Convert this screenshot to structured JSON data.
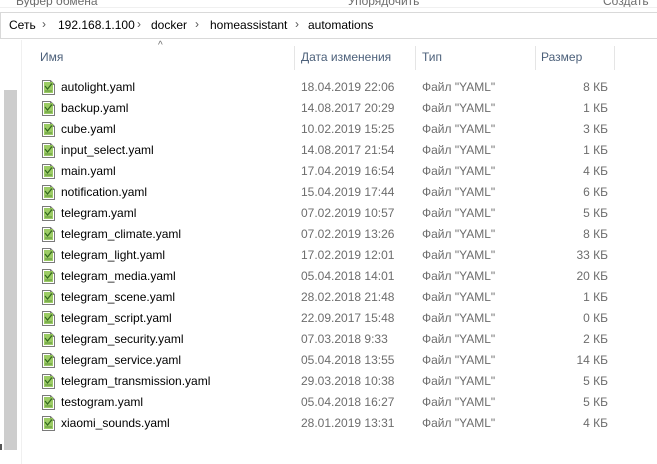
{
  "ribbon": {
    "left_label": "Буфер обмена",
    "middle_label": "Упорядочить",
    "right_label": "Создать"
  },
  "breadcrumb": {
    "segments": [
      "Сеть",
      "192.168.1.100",
      "docker",
      "homeassistant",
      "automations"
    ],
    "separator": "›"
  },
  "columns": {
    "name": "Имя",
    "date": "Дата изменения",
    "type": "Тип",
    "size": "Размер",
    "sort_indicator": "^"
  },
  "files": [
    {
      "name": "autolight.yaml",
      "date": "18.04.2019 22:06",
      "type": "Файл \"YAML\"",
      "size": "8 КБ"
    },
    {
      "name": "backup.yaml",
      "date": "14.08.2017 20:29",
      "type": "Файл \"YAML\"",
      "size": "1 КБ"
    },
    {
      "name": "cube.yaml",
      "date": "10.02.2019 15:25",
      "type": "Файл \"YAML\"",
      "size": "3 КБ"
    },
    {
      "name": "input_select.yaml",
      "date": "14.08.2017 21:54",
      "type": "Файл \"YAML\"",
      "size": "1 КБ"
    },
    {
      "name": "main.yaml",
      "date": "17.04.2019 16:54",
      "type": "Файл \"YAML\"",
      "size": "4 КБ"
    },
    {
      "name": "notification.yaml",
      "date": "15.04.2019 17:44",
      "type": "Файл \"YAML\"",
      "size": "6 КБ"
    },
    {
      "name": "telegram.yaml",
      "date": "07.02.2019 10:57",
      "type": "Файл \"YAML\"",
      "size": "5 КБ"
    },
    {
      "name": "telegram_climate.yaml",
      "date": "07.02.2019 13:26",
      "type": "Файл \"YAML\"",
      "size": "8 КБ"
    },
    {
      "name": "telegram_light.yaml",
      "date": "17.02.2019 12:01",
      "type": "Файл \"YAML\"",
      "size": "33 КБ"
    },
    {
      "name": "telegram_media.yaml",
      "date": "05.04.2018 14:01",
      "type": "Файл \"YAML\"",
      "size": "20 КБ"
    },
    {
      "name": "telegram_scene.yaml",
      "date": "28.02.2018 21:48",
      "type": "Файл \"YAML\"",
      "size": "1 КБ"
    },
    {
      "name": "telegram_script.yaml",
      "date": "22.09.2017 15:48",
      "type": "Файл \"YAML\"",
      "size": "0 КБ"
    },
    {
      "name": "telegram_security.yaml",
      "date": "07.03.2018 9:33",
      "type": "Файл \"YAML\"",
      "size": "2 КБ"
    },
    {
      "name": "telegram_service.yaml",
      "date": "05.04.2018 13:55",
      "type": "Файл \"YAML\"",
      "size": "14 КБ"
    },
    {
      "name": "telegram_transmission.yaml",
      "date": "29.03.2018 10:38",
      "type": "Файл \"YAML\"",
      "size": "5 КБ"
    },
    {
      "name": "testogram.yaml",
      "date": "05.04.2018 16:27",
      "type": "Файл \"YAML\"",
      "size": "5 КБ"
    },
    {
      "name": "xiaomi_sounds.yaml",
      "date": "28.01.2019 13:31",
      "type": "Файл \"YAML\"",
      "size": "4 КБ"
    }
  ],
  "icons": {
    "file": "yaml-file-icon",
    "chevron": "chevron-right-icon"
  },
  "colors": {
    "header_text": "#4c607a",
    "meta_text": "#6d6d6d",
    "icon_green": "#7cb342"
  }
}
